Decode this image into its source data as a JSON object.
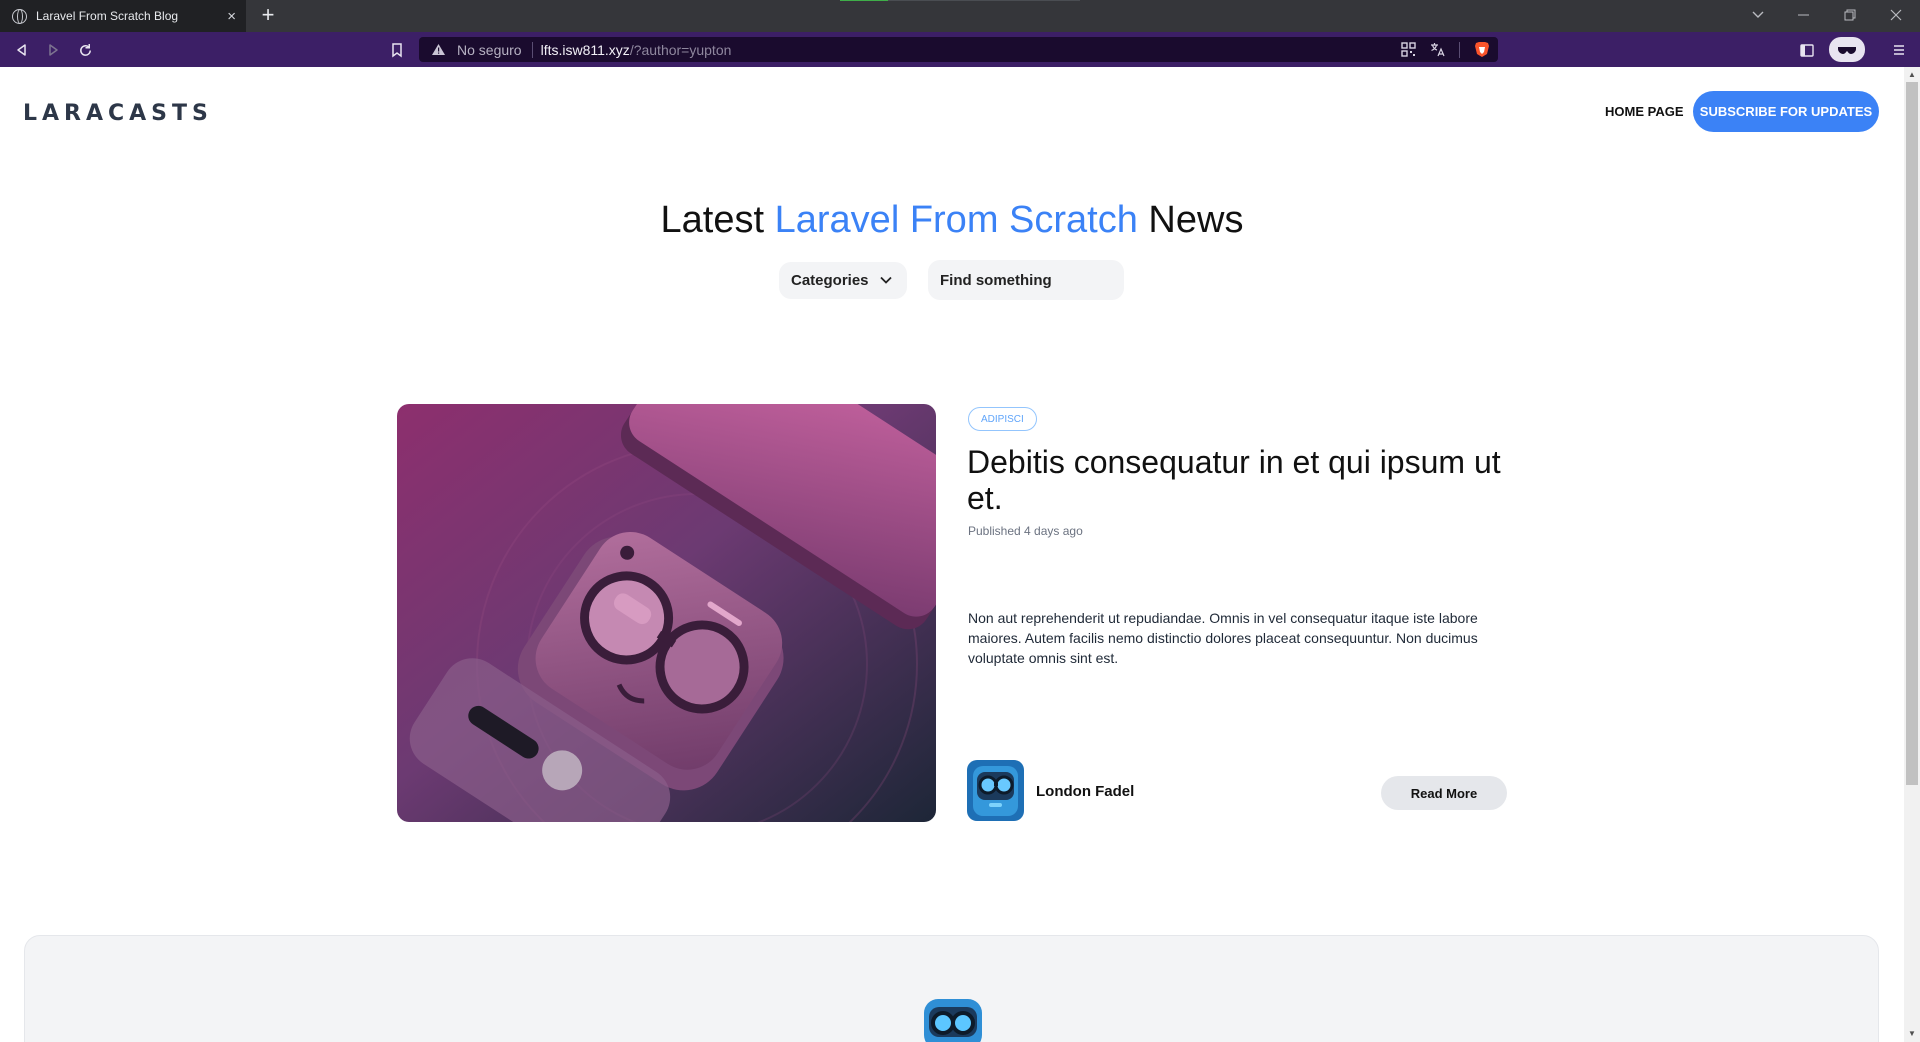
{
  "browser": {
    "tab_title": "Laravel From Scratch Blog",
    "new_tab": "+",
    "tab_close": "×",
    "security_label": "No seguro",
    "url_host": "lfts.isw811.xyz",
    "url_path": "/?author=yupton",
    "window_controls": {
      "minimize": "—",
      "restore": "❐",
      "close": "✕",
      "tab_search": "⌄"
    }
  },
  "header": {
    "logo_text": "LARACASTS",
    "nav_home": "HOME PAGE",
    "nav_subscribe": "SUBSCRIBE FOR UPDATES"
  },
  "hero": {
    "prefix": "Latest",
    "accent": "Laravel From Scratch",
    "suffix": "News"
  },
  "filters": {
    "categories_label": "Categories",
    "search_placeholder": "Find something"
  },
  "article": {
    "category": "ADIPISCI",
    "title": "Debitis consequatur in et qui ipsum ut et.",
    "published": "Published 4 days ago",
    "excerpt": "Non aut reprehenderit ut repudiandae. Omnis in vel consequatur itaque iste labore maiores. Autem facilis nemo distinctio dolores placeat consequuntur. Non ducimus voluptate omnis sint est.",
    "author": "London Fadel",
    "read_more": "Read More"
  },
  "colors": {
    "accent": "#3b82f6",
    "browser_toolbar": "#3c1f66",
    "tag_border": "#93c5fd"
  },
  "icons": [
    "globe-icon",
    "back-icon",
    "forward-icon",
    "reload-icon",
    "bookmark-icon",
    "warning-icon",
    "qr-icon",
    "translate-icon",
    "brave-shield-icon",
    "sidebar-icon",
    "glasses-icon",
    "menu-icon",
    "chevron-down-icon"
  ]
}
